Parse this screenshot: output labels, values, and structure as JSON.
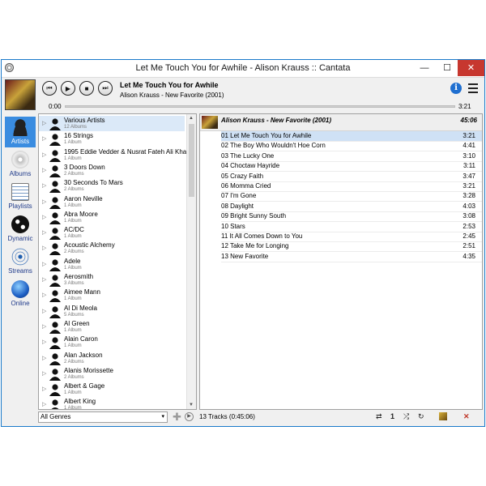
{
  "window": {
    "title": "Let Me Touch You for Awhile - Alison Krauss :: Cantata",
    "minimize": "—",
    "maximize": "☐",
    "close": "✕"
  },
  "player": {
    "track_title": "Let Me Touch You for Awhile",
    "track_subtitle": "Alison Krauss - New Favorite (2001)",
    "time_elapsed": "0:00",
    "time_total": "3:21",
    "progress": 0.0,
    "buttons": {
      "prev": "⏮",
      "play": "▶",
      "stop": "■",
      "next": "⏭"
    }
  },
  "sidebar": {
    "items": [
      {
        "label": "Artists",
        "active": true
      },
      {
        "label": "Albums",
        "active": false
      },
      {
        "label": "Playlists",
        "active": false
      },
      {
        "label": "Dynamic",
        "active": false
      },
      {
        "label": "Streams",
        "active": false
      },
      {
        "label": "Online",
        "active": false
      }
    ]
  },
  "artists": [
    {
      "name": "Various Artists",
      "count": "12 Albums"
    },
    {
      "name": "16 Strings",
      "count": "1 Album"
    },
    {
      "name": "1995 Eddie Vedder & Nusrat Fateh Ali Kha",
      "count": "1 Album"
    },
    {
      "name": "3 Doors Down",
      "count": "2 Albums"
    },
    {
      "name": "30 Seconds To Mars",
      "count": "2 Albums"
    },
    {
      "name": "Aaron Neville",
      "count": "1 Album"
    },
    {
      "name": "Abra Moore",
      "count": "1 Album"
    },
    {
      "name": "AC/DC",
      "count": "1 Album"
    },
    {
      "name": "Acoustic Alchemy",
      "count": "2 Albums"
    },
    {
      "name": "Adele",
      "count": "1 Album"
    },
    {
      "name": "Aerosmith",
      "count": "3 Albums"
    },
    {
      "name": "Aimee Mann",
      "count": "1 Album"
    },
    {
      "name": "Al Di Meola",
      "count": "5 Albums"
    },
    {
      "name": "Al Green",
      "count": "1 Album"
    },
    {
      "name": "Alain Caron",
      "count": "1 Album"
    },
    {
      "name": "Alan Jackson",
      "count": "2 Albums"
    },
    {
      "name": "Alanis Morissette",
      "count": "2 Albums"
    },
    {
      "name": "Albert & Gage",
      "count": "1 Album"
    },
    {
      "name": "Albert King",
      "count": "1 Album"
    }
  ],
  "genre_filter": {
    "selected": "All Genres",
    "arrow": "▾"
  },
  "album": {
    "title": "Alison Krauss - New Favorite (2001)",
    "duration": "45:06"
  },
  "tracks": [
    {
      "title": "01 Let Me Touch You for Awhile",
      "time": "3:21",
      "playing": true
    },
    {
      "title": "02 The Boy Who Wouldn't Hoe Corn",
      "time": "4:41"
    },
    {
      "title": "03 The Lucky One",
      "time": "3:10"
    },
    {
      "title": "04 Choctaw Hayride",
      "time": "3:11"
    },
    {
      "title": "05 Crazy Faith",
      "time": "3:47"
    },
    {
      "title": "06 Momma Cried",
      "time": "3:21"
    },
    {
      "title": "07 I'm Gone",
      "time": "3:28"
    },
    {
      "title": "08 Daylight",
      "time": "4:03"
    },
    {
      "title": "09 Bright Sunny South",
      "time": "3:08"
    },
    {
      "title": "10 Stars",
      "time": "2:53"
    },
    {
      "title": "11 It All Comes Down to You",
      "time": "2:45"
    },
    {
      "title": "12 Take Me for Longing",
      "time": "2:51"
    },
    {
      "title": "13 New Favorite",
      "time": "4:35"
    }
  ],
  "status": {
    "summary": "13 Tracks (0:45:06)",
    "repeat": "⇄",
    "single": "1",
    "shuffle": "⤮",
    "consume": "↻"
  },
  "colors": {
    "accent": "#3a8ce0",
    "playing_row": "#cfe1f5",
    "close": "#c7372f"
  }
}
